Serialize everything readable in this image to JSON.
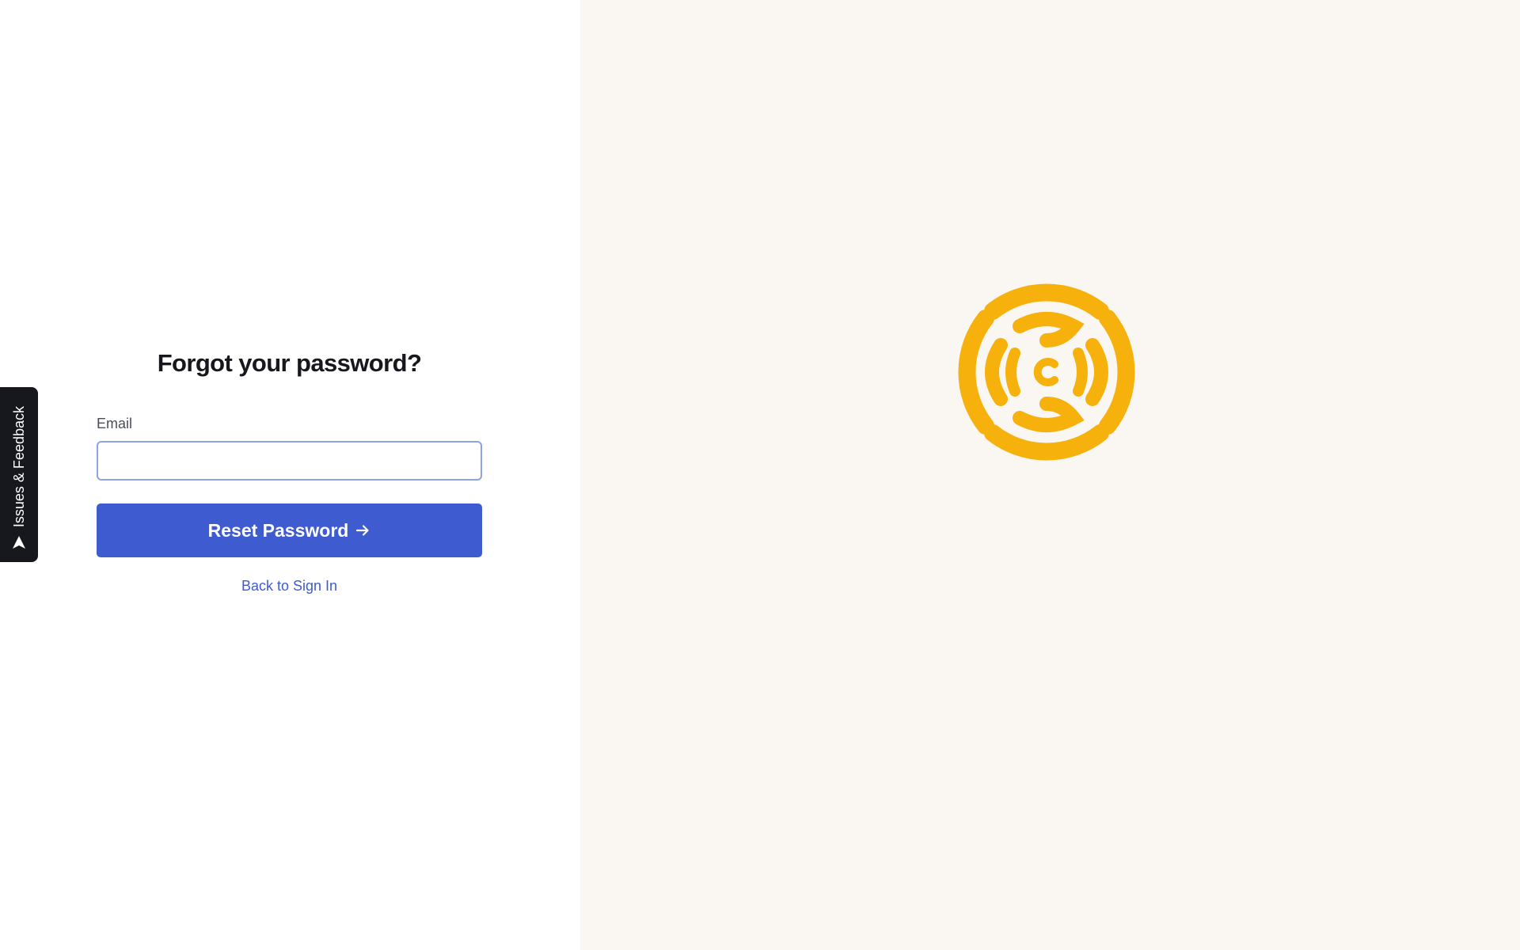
{
  "form": {
    "title": "Forgot your password?",
    "email_label": "Email",
    "email_value": "",
    "email_placeholder": "",
    "reset_button_label": "Reset Password",
    "back_link_label": "Back to Sign In"
  },
  "feedback_tab": {
    "label": "Issues & Feedback",
    "icon": "send-icon"
  },
  "brand": {
    "logo_icon": "brand-logo-icon",
    "logo_color": "#f7b10d"
  },
  "colors": {
    "accent": "#3f5bd0",
    "right_panel_background": "#faf6f1",
    "feedback_tab_background": "#16181d"
  }
}
